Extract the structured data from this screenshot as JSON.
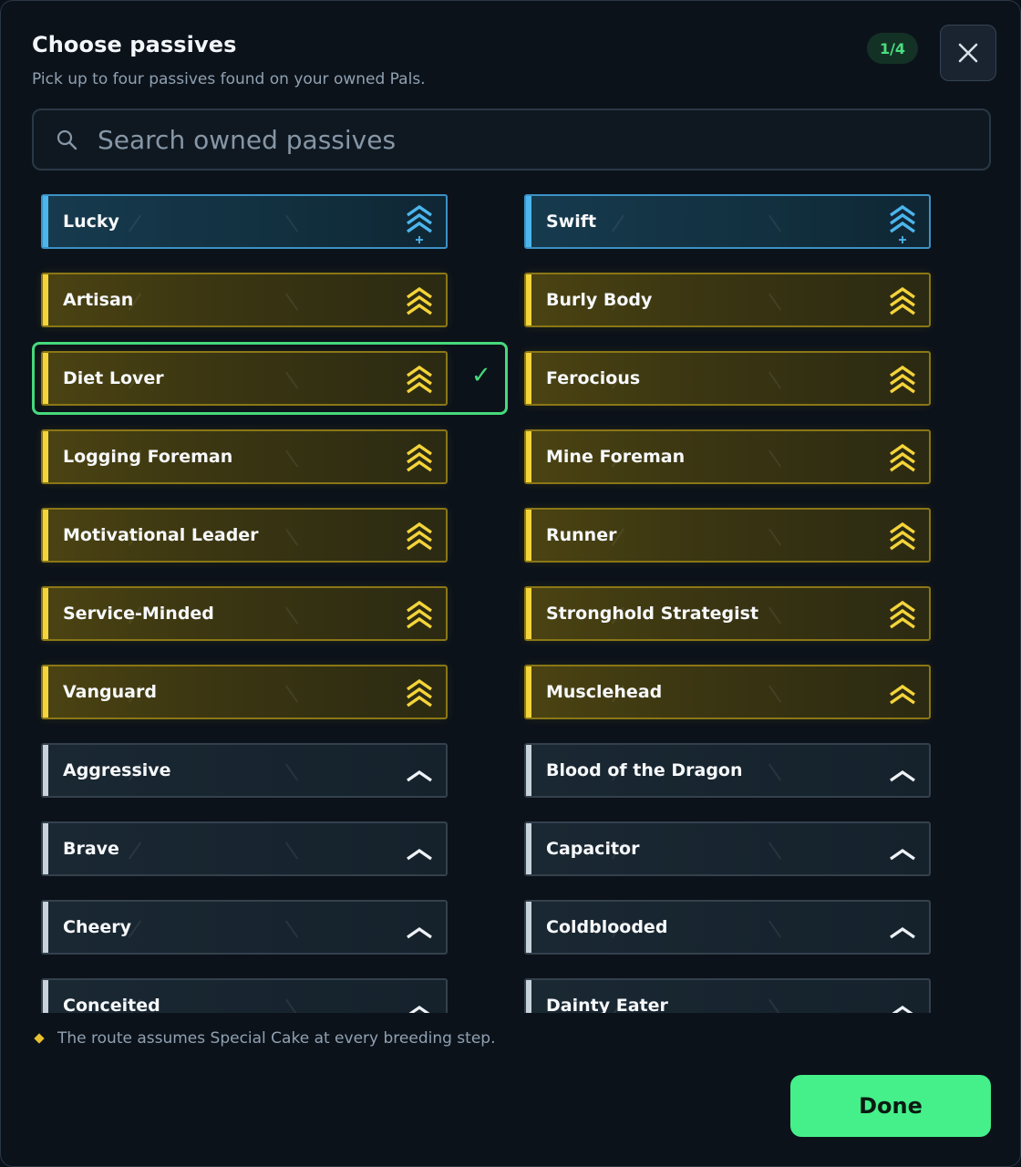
{
  "header": {
    "title": "Choose passives",
    "subtitle": "Pick up to four passives found on your owned Pals.",
    "count": "1/4"
  },
  "search": {
    "placeholder": "Search owned passives",
    "value": ""
  },
  "passives": [
    {
      "name": "Lucky",
      "tier": "legendary",
      "selected": false
    },
    {
      "name": "Swift",
      "tier": "legendary",
      "selected": false
    },
    {
      "name": "Artisan",
      "tier": "gold",
      "selected": false
    },
    {
      "name": "Burly Body",
      "tier": "gold",
      "selected": false
    },
    {
      "name": "Diet Lover",
      "tier": "gold",
      "selected": true
    },
    {
      "name": "Ferocious",
      "tier": "gold",
      "selected": false
    },
    {
      "name": "Logging Foreman",
      "tier": "gold",
      "selected": false
    },
    {
      "name": "Mine Foreman",
      "tier": "gold",
      "selected": false
    },
    {
      "name": "Motivational Leader",
      "tier": "gold",
      "selected": false
    },
    {
      "name": "Runner",
      "tier": "gold",
      "selected": false
    },
    {
      "name": "Service-Minded",
      "tier": "gold",
      "selected": false
    },
    {
      "name": "Stronghold Strategist",
      "tier": "gold",
      "selected": false
    },
    {
      "name": "Vanguard",
      "tier": "gold",
      "selected": false
    },
    {
      "name": "Musclehead",
      "tier": "gold2",
      "selected": false
    },
    {
      "name": "Aggressive",
      "tier": "basic",
      "selected": false
    },
    {
      "name": "Blood of the Dragon",
      "tier": "basic",
      "selected": false
    },
    {
      "name": "Brave",
      "tier": "basic",
      "selected": false
    },
    {
      "name": "Capacitor",
      "tier": "basic",
      "selected": false
    },
    {
      "name": "Cheery",
      "tier": "basic",
      "selected": false
    },
    {
      "name": "Coldblooded",
      "tier": "basic",
      "selected": false
    },
    {
      "name": "Conceited",
      "tier": "basic",
      "selected": false
    },
    {
      "name": "Dainty Eater",
      "tier": "basic",
      "selected": false
    }
  ],
  "footer": {
    "note": "The route assumes Special Cake at every breeding step.",
    "done_label": "Done"
  },
  "icons": {
    "close": "close-icon",
    "search": "search-icon",
    "check": "checkmark-icon",
    "rank_legendary": "triple-chevron-plus-icon",
    "rank_gold": "triple-chevron-icon",
    "rank_gold2": "double-chevron-icon",
    "rank_basic": "single-chevron-icon"
  },
  "colors": {
    "accent_green": "#46d97c",
    "legendary_blue": "#4cb6ec",
    "gold": "#f4d43a",
    "basic_gray": "#c8d2db",
    "background": "#0c121a"
  }
}
